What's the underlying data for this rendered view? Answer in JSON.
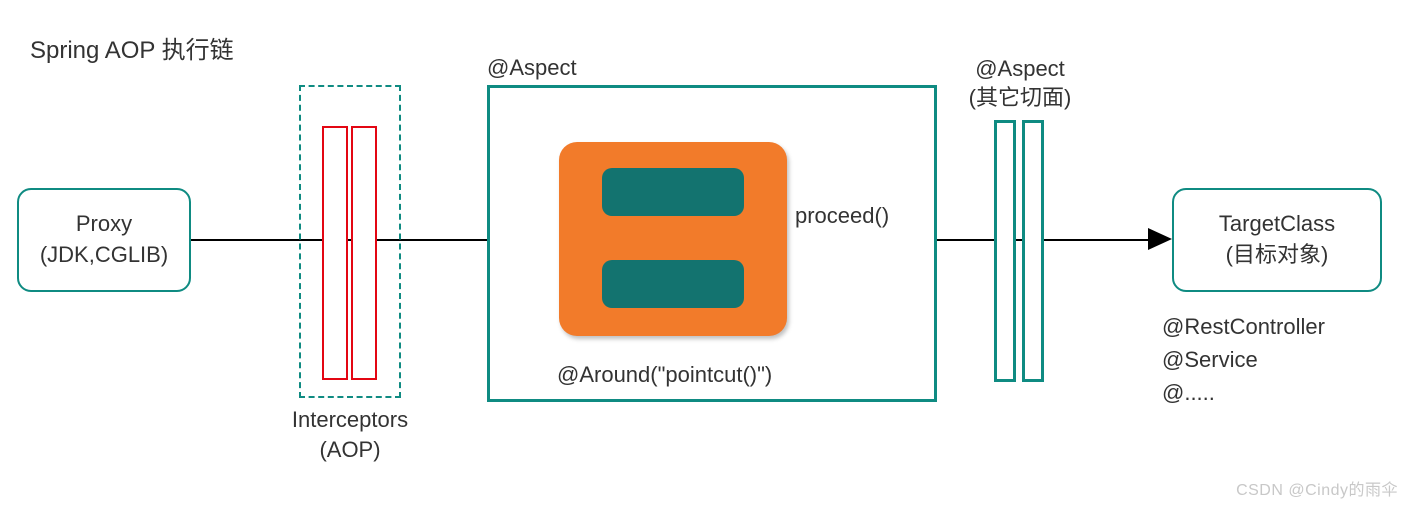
{
  "title": "Spring AOP 执行链",
  "proxy": {
    "line1": "Proxy",
    "line2": "(JDK,CGLIB)"
  },
  "interceptors": {
    "line1": "Interceptors",
    "line2": "(AOP)"
  },
  "aspect": {
    "label": "@Aspect",
    "around": "@Around(\"pointcut()\")",
    "proceed": "proceed()"
  },
  "other_aspect": {
    "line1": "@Aspect",
    "line2": "(其它切面)"
  },
  "target": {
    "line1": "TargetClass",
    "line2": "(目标对象)"
  },
  "annotations": {
    "a1": "@RestController",
    "a2": "@Service",
    "a3": "@....."
  },
  "watermark": "CSDN @Cindy的雨伞"
}
